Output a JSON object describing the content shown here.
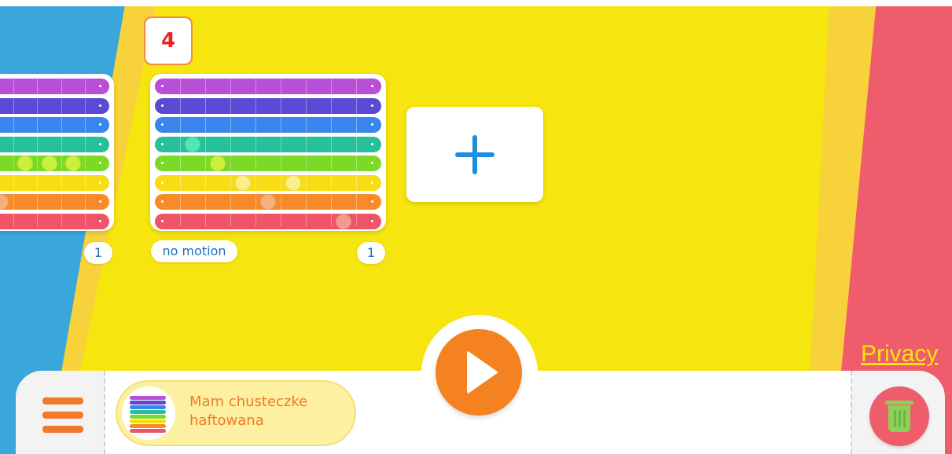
{
  "pattern_number": "4",
  "pattern_card": {
    "motion_label": "no motion",
    "repeat_count": "1",
    "bar_colors": [
      "#b84fd6",
      "#5a4bd6",
      "#3b86ee",
      "#27c09a",
      "#7bd927",
      "#f8dc14",
      "#f88a2a",
      "#ef5566"
    ],
    "notes": [
      {
        "row": 3,
        "step": 1
      },
      {
        "row": 4,
        "step": 2
      },
      {
        "row": 5,
        "step": 3
      },
      {
        "row": 5,
        "step": 5
      },
      {
        "row": 6,
        "step": 4
      },
      {
        "row": 7,
        "step": 7
      }
    ],
    "steps": 9
  },
  "prev_card": {
    "repeat_count": "1",
    "notes": [
      {
        "row": 4,
        "step": 1
      },
      {
        "row": 4,
        "step": 2
      },
      {
        "row": 4,
        "step": 3
      },
      {
        "row": 6,
        "step": 0
      }
    ]
  },
  "add_button": {
    "icon": "plus-icon"
  },
  "privacy_link": "Privacy",
  "bottom_bar": {
    "menu_icon": "hamburger-menu-icon",
    "song_title": "Mam chusteczke\nhaftowana",
    "play_icon": "play-icon",
    "trash_icon": "trash-icon"
  },
  "colors": {
    "blue_bg": "#3aa6dc",
    "yellow_bg": "#f6e50e",
    "pink_bg": "#ef5c6c",
    "orange_accent": "#f58220",
    "plus_blue": "#1a8fe0"
  }
}
